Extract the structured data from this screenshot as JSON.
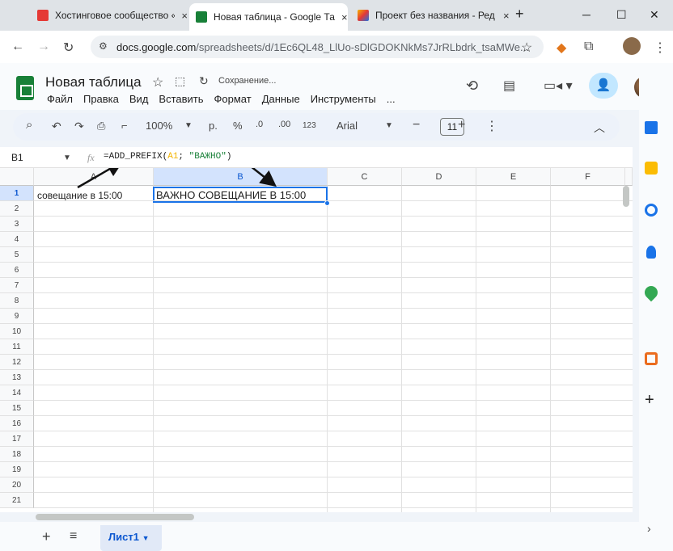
{
  "browser": {
    "tabs": [
      {
        "title": "Хостинговое сообщество «",
        "close": "×"
      },
      {
        "title": "Новая таблица - Google Та",
        "close": "×"
      },
      {
        "title": "Проект без названия - Ред",
        "close": "×"
      }
    ],
    "new_tab": "+",
    "url_host": "docs.google.com",
    "url_path": "/spreadsheets/d/1Ec6QL48_LlUo-sDlGDOKNkMs7JrRLbdrk_tsaMWe..."
  },
  "sheets": {
    "doc_title": "Новая таблица",
    "saving_status": "Сохранение...",
    "menu": [
      "Файл",
      "Правка",
      "Вид",
      "Вставить",
      "Формат",
      "Данные",
      "Инструменты",
      "..."
    ],
    "toolbar": {
      "zoom": "100%",
      "currency": "р.",
      "percent": "%",
      "dec_decrease": ".0",
      "dec_increase": ".00",
      "number_format": "123",
      "font": "Arial",
      "font_size": "11"
    },
    "name_box": "B1",
    "fx": "fx",
    "formula_prefix": "=ADD_PREFIX(",
    "formula_ref": "A1",
    "formula_sep": "; ",
    "formula_str": "\"ВАЖНО\"",
    "formula_end": ")",
    "columns": [
      "A",
      "B",
      "C",
      "D",
      "E",
      "F"
    ],
    "rows": [
      "1",
      "2",
      "3",
      "4",
      "5",
      "6",
      "7",
      "8",
      "9",
      "10",
      "11",
      "12",
      "13",
      "14",
      "15",
      "16",
      "17",
      "18",
      "19",
      "20",
      "21"
    ],
    "cell_a1": "совещание в 15:00",
    "cell_b1": "ВАЖНО СОВЕЩАНИЕ В 15:00",
    "sheet_tab": "Лист1",
    "accent_color": "#1a73e8",
    "brand_green": "#188038"
  },
  "icons": [
    "search-icon",
    "undo-icon",
    "redo-icon",
    "print-icon",
    "paint-format-icon",
    "history-icon",
    "comment-icon",
    "meet-icon",
    "share-icon",
    "star-icon",
    "move-icon",
    "cloud-icon",
    "calendar-icon",
    "keep-icon",
    "tasks-icon",
    "contacts-icon",
    "maps-icon",
    "office-icon",
    "plus-icon",
    "arrow-annotation"
  ]
}
